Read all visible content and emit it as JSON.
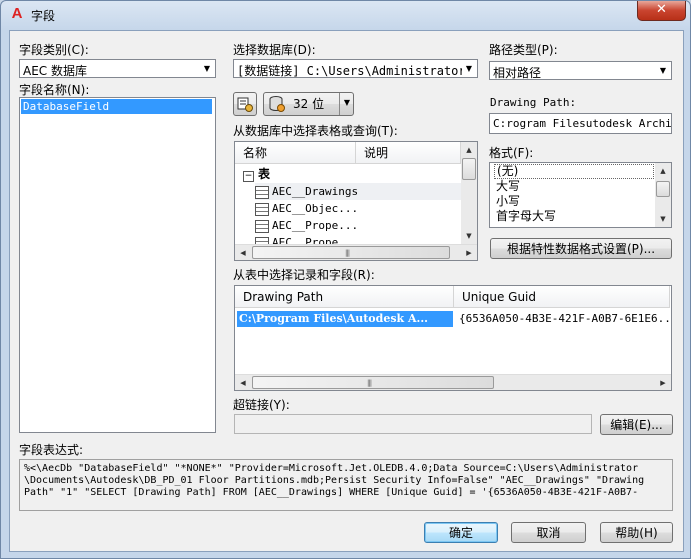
{
  "window": {
    "title": "字段",
    "close_label": "✕"
  },
  "left": {
    "category_label": "字段类别(C):",
    "category_value": "AEC 数据库",
    "name_label": "字段名称(N):",
    "names": [
      "DatabaseField"
    ]
  },
  "db": {
    "select_label": "选择数据库(D):",
    "select_value": "[数据链接] C:\\Users\\Administrator\\Doc",
    "bitness_value": "32 位",
    "tables_label": "从数据库中选择表格或查询(T):",
    "tree_headers": [
      "名称",
      "说明"
    ],
    "tree_group": "表",
    "tree_items": [
      "AEC__Drawings",
      "AEC__Objec...",
      "AEC__Prope...",
      "AEC__Prope..."
    ]
  },
  "path": {
    "type_label": "路径类型(P):",
    "type_value": "相对路径",
    "drawing_path_label": "Drawing Path:",
    "drawing_path_value": "C:rogram Filesutodesk Architec",
    "format_label": "格式(F):",
    "formats": [
      "(无)",
      "大写",
      "小写",
      "首字母大写"
    ],
    "format_button": "根据特性数据格式设置(P)..."
  },
  "records": {
    "label": "从表中选择记录和字段(R):",
    "headers": [
      "Drawing Path",
      "Unique Guid"
    ],
    "row": [
      "C:\\Program Files\\Autodesk A...",
      "{6536A050-4B3E-421F-A0B7-6E1E6..."
    ]
  },
  "hyperlink": {
    "label": "超链接(Y):",
    "edit_button": "编辑(E)..."
  },
  "expression": {
    "label": "字段表达式:",
    "lines": [
      "%<\\AecDb \"DatabaseField\" \"*NONE*\" \"Provider=Microsoft.Jet.OLEDB.4.0;Data Source=C:\\Users\\Administrator",
      "\\Documents\\Autodesk\\DB_PD_01 Floor Partitions.mdb;Persist Security Info=False\" \"AEC__Drawings\" \"Drawing",
      "Path\" \"1\" \"SELECT [Drawing Path] FROM [AEC__Drawings] WHERE [Unique Guid] = '{6536A050-4B3E-421F-A0B7-"
    ]
  },
  "buttons": {
    "ok": "确定",
    "cancel": "取消",
    "help": "帮助(H)"
  }
}
